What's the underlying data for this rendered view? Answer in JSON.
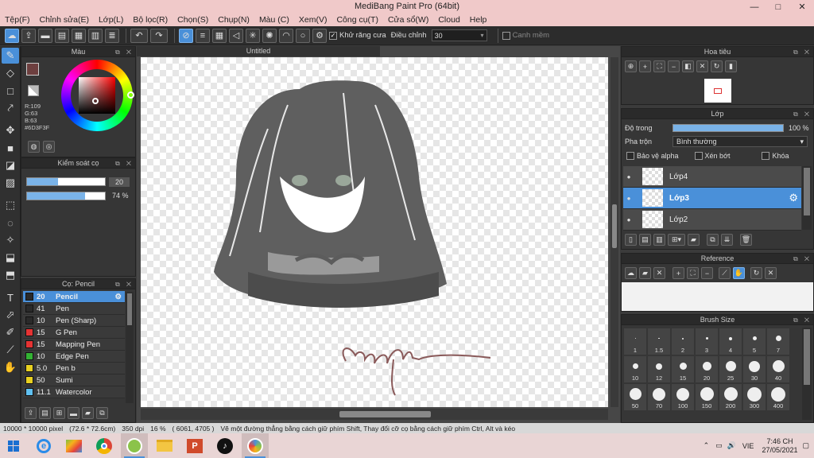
{
  "window": {
    "title": "MediBang Paint Pro (64bit)",
    "min": "—",
    "max": "□",
    "close": "✕"
  },
  "menu": [
    "Tệp(F)",
    "Chỉnh sửa(E)",
    "Lớp(L)",
    "Bộ lọc(R)",
    "Chọn(S)",
    "Chụp(N)",
    "Màu (C)",
    "Xem(V)",
    "Công cụ(T)",
    "Cửa sổ(W)",
    "Cloud",
    "Help"
  ],
  "toolbar": {
    "antialias_label": "Khử răng cưa",
    "antialias_checked": true,
    "adjust_label": "Điều chỉnh",
    "adjust_value": "30",
    "snap_label": "Canh mềm"
  },
  "color_panel": {
    "title": "Màu",
    "r": "R:109",
    "g": "G:63",
    "b": "B:63",
    "hex": "#6D3F3F",
    "primary_color": "#6d3f3f"
  },
  "brush_control": {
    "title": "Kiểm soát cọ",
    "size_value": "20",
    "size_fill": 0.4,
    "opacity_value": "74 %",
    "opacity_fill": 0.74
  },
  "brush_list": {
    "title": "Cọ: Pencil",
    "items": [
      {
        "size": "20",
        "name": "Pencil",
        "color": "#2a2a2a",
        "selected": true
      },
      {
        "size": "41",
        "name": "Pen",
        "color": "#2a2a2a"
      },
      {
        "size": "10",
        "name": "Pen (Sharp)",
        "color": "#2a2a2a"
      },
      {
        "size": "15",
        "name": "G Pen",
        "color": "#e53333"
      },
      {
        "size": "15",
        "name": "Mapping Pen",
        "color": "#e53333"
      },
      {
        "size": "10",
        "name": "Edge Pen",
        "color": "#33b233"
      },
      {
        "size": "5.0",
        "name": "Pen b",
        "color": "#e8d020"
      },
      {
        "size": "50",
        "name": "Sumi",
        "color": "#e8d020"
      },
      {
        "size": "11.1",
        "name": "Watercolor",
        "color": "#60c0f0"
      }
    ]
  },
  "document": {
    "tab_label": "Untitled"
  },
  "navigator": {
    "title": "Hoa tiêu"
  },
  "layers": {
    "title": "Lớp",
    "opacity_label": "Độ trong",
    "opacity_value": "100 %",
    "blend_label": "Pha trộn",
    "blend_value": "Bình thường",
    "protect_alpha_label": "Bảo vệ alpha",
    "clipping_label": "Xén bớt",
    "lock_label": "Khóa",
    "items": [
      {
        "name": "Lớp4",
        "selected": false
      },
      {
        "name": "Lớp3",
        "selected": true
      },
      {
        "name": "Lớp2",
        "selected": false
      }
    ]
  },
  "reference": {
    "title": "Reference"
  },
  "brush_size": {
    "title": "Brush Size",
    "sizes": [
      "1",
      "1.5",
      "2",
      "3",
      "4",
      "5",
      "7",
      "10",
      "12",
      "15",
      "20",
      "25",
      "30",
      "40",
      "50",
      "70",
      "100",
      "150",
      "200",
      "300",
      "400"
    ]
  },
  "status": {
    "dims": "10000 * 10000 pixel",
    "cm": "(72.6 * 72.6cm)",
    "dpi": "350 dpi",
    "zoom": "16 %",
    "coords": "( 6061, 4705 )",
    "hint": "Vẽ một đường thẳng bằng cách giữ phím Shift, Thay đổi cỡ cọ bằng cách giữ phím Ctrl, Alt và kéo"
  },
  "taskbar": {
    "lang": "VIE",
    "time": "7:46 CH",
    "date": "27/05/2021"
  }
}
